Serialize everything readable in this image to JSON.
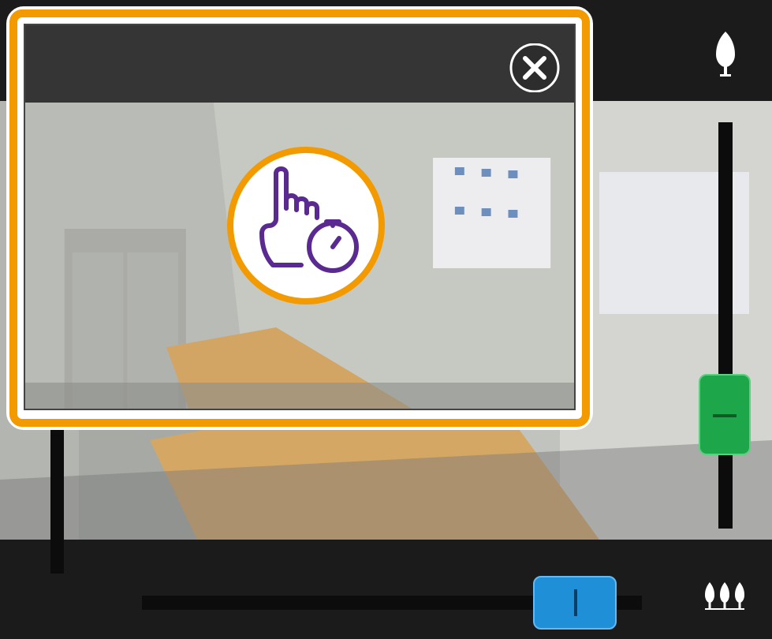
{
  "popup": {
    "close_icon": "close-icon",
    "badge_icon": "touch-and-hold-timer-icon",
    "accent_color": "#f29a00",
    "badge_icon_color": "#5a2a91"
  },
  "controls": {
    "focus_near_icon": "single-tree-icon",
    "focus_far_icon": "three-trees-icon",
    "vertical_slider_color": "#1ea64a",
    "horizontal_slider_color": "#1f8fd8"
  }
}
